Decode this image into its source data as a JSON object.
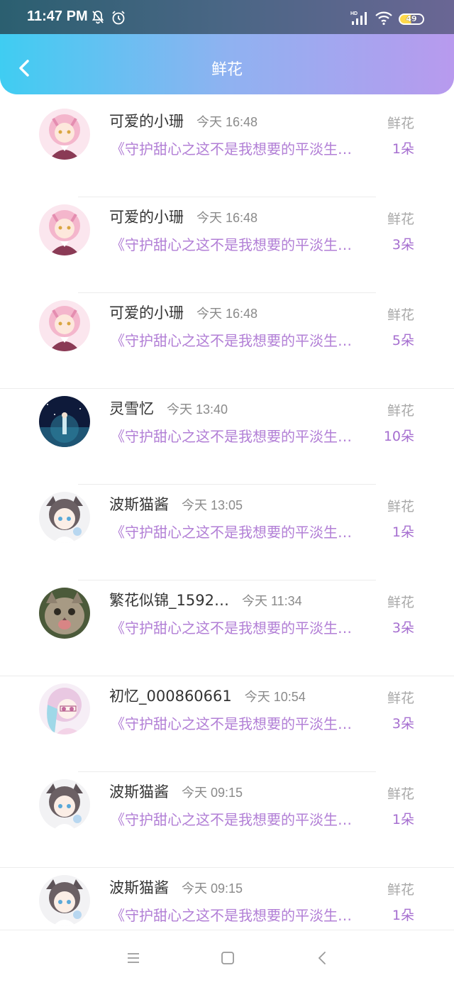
{
  "status": {
    "time": "11:47 PM",
    "battery": "49"
  },
  "header": {
    "title": "鲜花"
  },
  "colors": {
    "accent": "#b27fd6",
    "count": "#a66fd0",
    "gradient_start": "#3fcdf2",
    "gradient_end": "#b89aee"
  },
  "items": [
    {
      "name": "可爱的小珊",
      "time": "今天 16:48",
      "message": "《守护甜心之这不是我想要的平淡生…",
      "label": "鲜花",
      "count": "1朵",
      "avatar": "pink-anime-avatar"
    },
    {
      "name": "可爱的小珊",
      "time": "今天 16:48",
      "message": "《守护甜心之这不是我想要的平淡生…",
      "label": "鲜花",
      "count": "3朵",
      "avatar": "pink-anime-avatar"
    },
    {
      "name": "可爱的小珊",
      "time": "今天 16:48",
      "message": "《守护甜心之这不是我想要的平淡生…",
      "label": "鲜花",
      "count": "5朵",
      "avatar": "pink-anime-avatar"
    },
    {
      "name": "灵雪忆",
      "time": "今天 13:40",
      "message": "《守护甜心之这不是我想要的平淡生…",
      "label": "鲜花",
      "count": "10朵",
      "avatar": "night-sky-avatar"
    },
    {
      "name": "波斯猫酱",
      "time": "今天 13:05",
      "message": "《守护甜心之这不是我想要的平淡生…",
      "label": "鲜花",
      "count": "1朵",
      "avatar": "cat-girl-avatar"
    },
    {
      "name": "繁花似锦_1592…",
      "time": "今天 11:34",
      "message": "《守护甜心之这不是我想要的平淡生…",
      "label": "鲜花",
      "count": "3朵",
      "avatar": "cat-photo-avatar"
    },
    {
      "name": "初忆_000860661",
      "time": "今天 10:54",
      "message": "《守护甜心之这不是我想要的平淡生…",
      "label": "鲜花",
      "count": "3朵",
      "avatar": "pastel-girl-avatar"
    },
    {
      "name": "波斯猫酱",
      "time": "今天 09:15",
      "message": "《守护甜心之这不是我想要的平淡生…",
      "label": "鲜花",
      "count": "1朵",
      "avatar": "cat-girl-avatar"
    },
    {
      "name": "波斯猫酱",
      "time": "今天 09:15",
      "message": "《守护甜心之这不是我想要的平淡生…",
      "label": "鲜花",
      "count": "1朵",
      "avatar": "cat-girl-avatar"
    }
  ]
}
